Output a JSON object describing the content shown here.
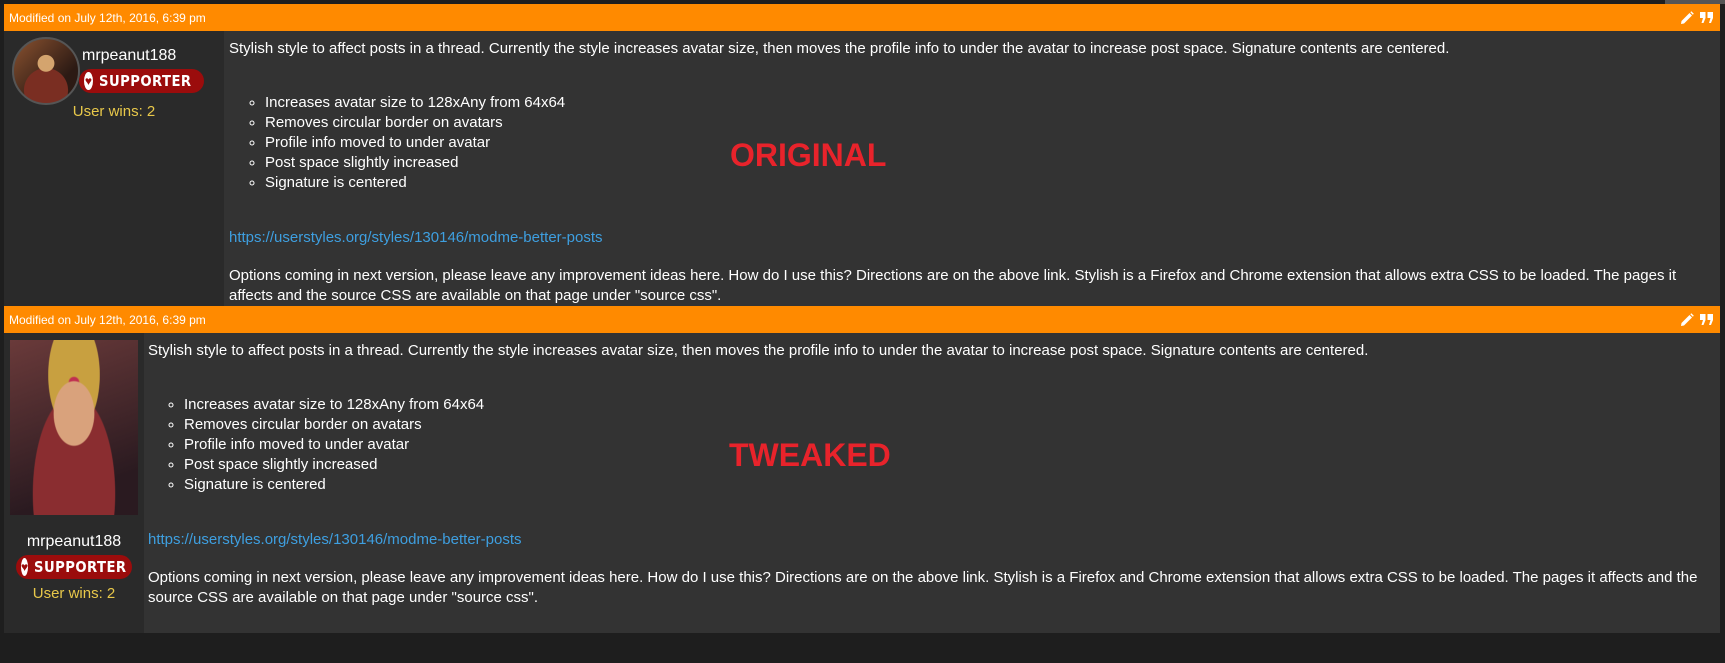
{
  "posts": [
    {
      "modified": "Modified on July 12th, 2016, 6:39 pm",
      "username": "mrpeanut188",
      "badge": "SUPPORTER",
      "wins": "User wins: 2",
      "intro": "Stylish style to affect posts in a thread. Currently the style increases avatar size, then moves the profile info to under the avatar to increase post space. Signature contents are centered.",
      "list": [
        "Increases avatar size to 128xAny from 64x64",
        "Removes circular border on avatars",
        "Profile info moved to under avatar",
        "Post space slightly increased",
        "Signature is centered"
      ],
      "link": "https://userstyles.org/styles/130146/modme-better-posts",
      "options": "Options coming in next version, please leave any improvement ideas here. How do I use this? Directions are on the above link. Stylish is a Firefox and Chrome extension that allows extra CSS to be loaded. The pages it affects and the source CSS are available on that page under \"source css\".",
      "overlay": "ORIGINAL"
    },
    {
      "modified": "Modified on July 12th, 2016, 6:39 pm",
      "username": "mrpeanut188",
      "badge": "SUPPORTER",
      "wins": "User wins: 2",
      "intro": "Stylish style to affect posts in a thread. Currently the style increases avatar size, then moves the profile info to under the avatar to increase post space. Signature contents are centered.",
      "list": [
        "Increases avatar size to 128xAny from 64x64",
        "Removes circular border on avatars",
        "Profile info moved to under avatar",
        "Post space slightly increased",
        "Signature is centered"
      ],
      "link": "https://userstyles.org/styles/130146/modme-better-posts",
      "options": "Options coming in next version, please leave any improvement ideas here. How do I use this? Directions are on the above link. Stylish is a Firefox and Chrome extension that allows extra CSS to be loaded. The pages it affects and the source CSS are available on that page under \"source css\".",
      "overlay": "TWEAKED"
    }
  ],
  "icons": {
    "edit": "pencil-icon",
    "quote": "quote-icon",
    "badge_heart": "heart-icon"
  },
  "colors": {
    "header": "#ff8a00",
    "link": "#3e9fe0",
    "wins": "#e8c84a",
    "badge": "#9b0c0c",
    "overlay": "#e8232b"
  }
}
